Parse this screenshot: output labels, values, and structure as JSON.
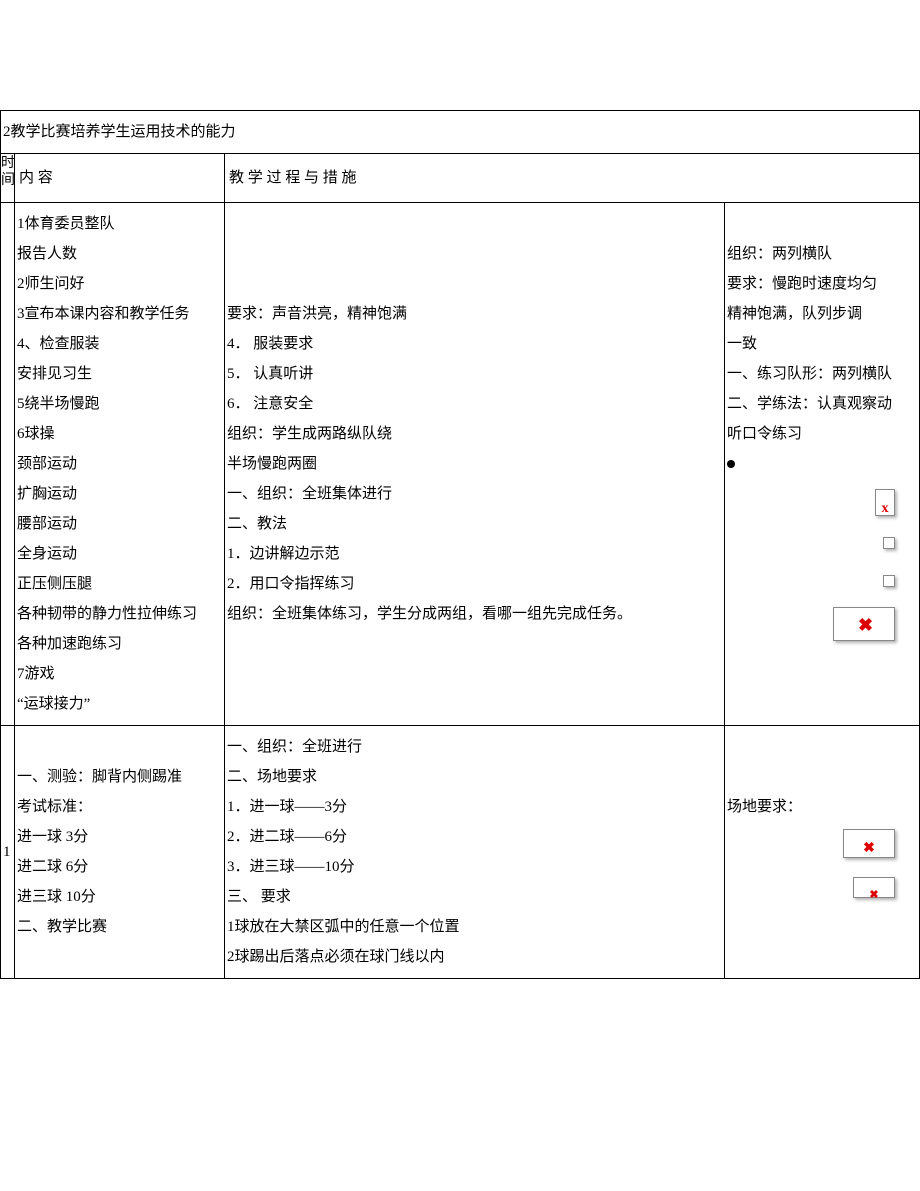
{
  "top_note": "2教学比赛培养学生运用技术的能力",
  "headers": {
    "time": "时间",
    "content": "内 容",
    "process": "教 学 过 程 与 措 施"
  },
  "row1": {
    "content": [
      "1体育委员整队",
      "报告人数",
      "2师生问好",
      "3宣布本课内容和教学任务",
      "4、检查服装",
      "安排见习生",
      "5绕半场慢跑",
      "6球操",
      "颈部运动",
      "扩胸运动",
      "腰部运动",
      "全身运动",
      "正压侧压腿",
      "各种韧带的静力性拉伸练习",
      "各种加速跑练习",
      "7游戏",
      "“运球接力”"
    ],
    "process": [
      "",
      "",
      "",
      "要求：声音洪亮，精神饱满",
      "4． 服装要求",
      "5． 认真听讲",
      "6． 注意安全",
      "组织：学生成两路纵队绕",
      "半场慢跑两圈",
      "一、组织：全班集体进行",
      "二、教法",
      "1．边讲解边示范",
      "2．用口令指挥练习",
      "组织：全班集体练习，学生分成两组，看哪一组先完成任务。"
    ],
    "org": [
      "",
      "组织：两列横队",
      "要求：慢跑时速度均匀",
      "精神饱满，队列步调",
      "一致",
      "一、练习队形：两列横队",
      "二、学练法：认真观察动",
      "听口令练习"
    ]
  },
  "row2": {
    "time": "1",
    "content": [
      "",
      "一、测验：脚背内侧踢准",
      "考试标准：",
      "进一球 3分",
      "进二球 6分",
      "进三球 10分",
      "二、教学比赛"
    ],
    "process": [
      "一、组织：全班进行",
      "二、场地要求",
      "1．进一球——3分",
      "2．进二球——6分",
      "3．进三球——10分",
      "三、 要求",
      "1球放在大禁区弧中的任意一个位置",
      "2球踢出后落点必须在球门线以内"
    ],
    "org": [
      "",
      "",
      "场地要求："
    ]
  }
}
